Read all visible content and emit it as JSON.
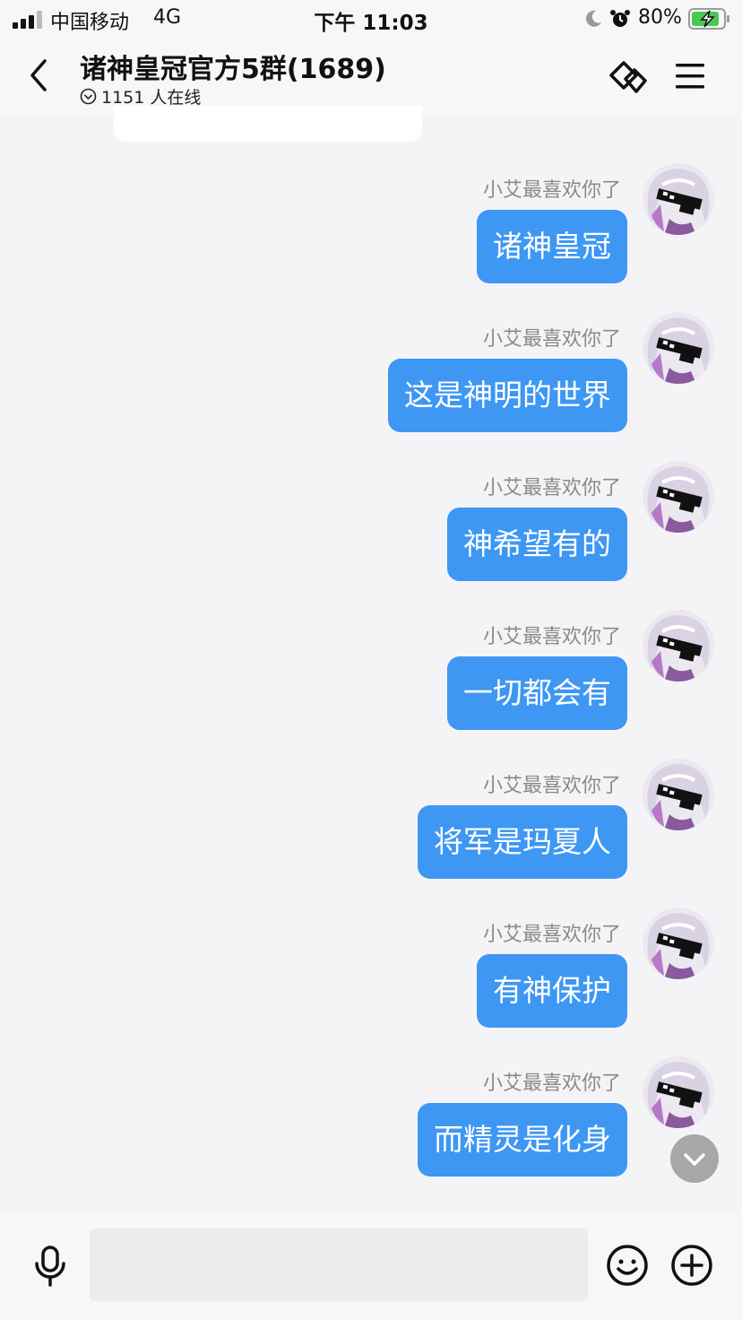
{
  "status_bar": {
    "carrier": "中国移动",
    "network": "4G",
    "time": "下午 11:03",
    "battery_percent": "80%",
    "icons": [
      "signal-icon",
      "moon-icon",
      "alarm-icon",
      "battery-charging-icon"
    ]
  },
  "header": {
    "title": "诸神皇冠官方5群(1689)",
    "online_count": "1151 人在线",
    "icons": [
      "back-icon",
      "online-status-icon",
      "group-link-icon",
      "menu-icon"
    ]
  },
  "messages": [
    {
      "sender": "小艾最喜欢你了",
      "text": "诸神皇冠"
    },
    {
      "sender": "小艾最喜欢你了",
      "text": "这是神明的世界"
    },
    {
      "sender": "小艾最喜欢你了",
      "text": "神希望有的"
    },
    {
      "sender": "小艾最喜欢你了",
      "text": "一切都会有"
    },
    {
      "sender": "小艾最喜欢你了",
      "text": "将军是玛夏人"
    },
    {
      "sender": "小艾最喜欢你了",
      "text": "有神保护"
    },
    {
      "sender": "小艾最喜欢你了",
      "text": "而精灵是化身"
    }
  ],
  "input_bar": {
    "icons": [
      "microphone-icon",
      "emoji-icon",
      "plus-icon"
    ]
  },
  "colors": {
    "accent": "#3d97f3",
    "background": "#f4f4f6",
    "sender_text": "#8a8a8e"
  }
}
